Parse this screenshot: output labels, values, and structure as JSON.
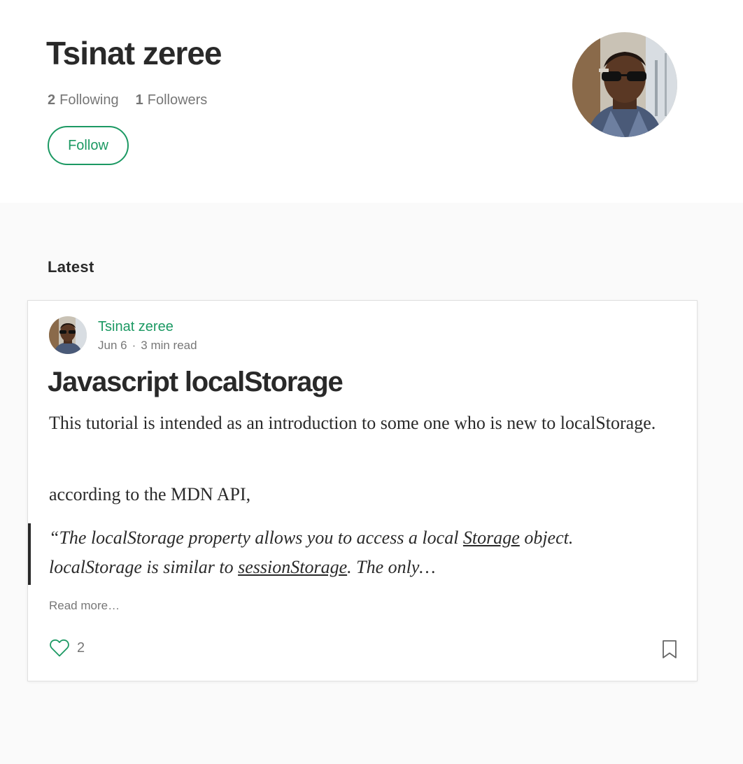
{
  "profile": {
    "name": "Tsinat zeree",
    "following_count": "2",
    "following_label": "Following",
    "followers_count": "1",
    "followers_label": "Followers",
    "follow_button_label": "Follow"
  },
  "latest": {
    "section_title": "Latest"
  },
  "post": {
    "author": "Tsinat zeree",
    "date": "Jun 6",
    "separator": "·",
    "read_time": "3 min read",
    "title": "Javascript localStorage",
    "paragraph1": "This tutorial is intended as an introduction to some one who is new to localStorage.",
    "paragraph2": "according to the MDN API,",
    "quote": {
      "line1_prefix": "“The localStorage property allows you to access a local ",
      "line1_link": "Storage",
      "line1_suffix": " object.",
      "line2_prefix": "localStorage is similar to ",
      "line2_link": "sessionStorage",
      "line2_suffix": ". The only…"
    },
    "read_more": "Read more…",
    "clap_count": "2"
  },
  "colors": {
    "accent": "#1c9963",
    "page_background": "#fafafa",
    "card_background": "#ffffff",
    "muted_text": "#757575"
  },
  "icons": {
    "clap": "heart-outline-icon",
    "bookmark": "bookmark-outline-icon"
  }
}
